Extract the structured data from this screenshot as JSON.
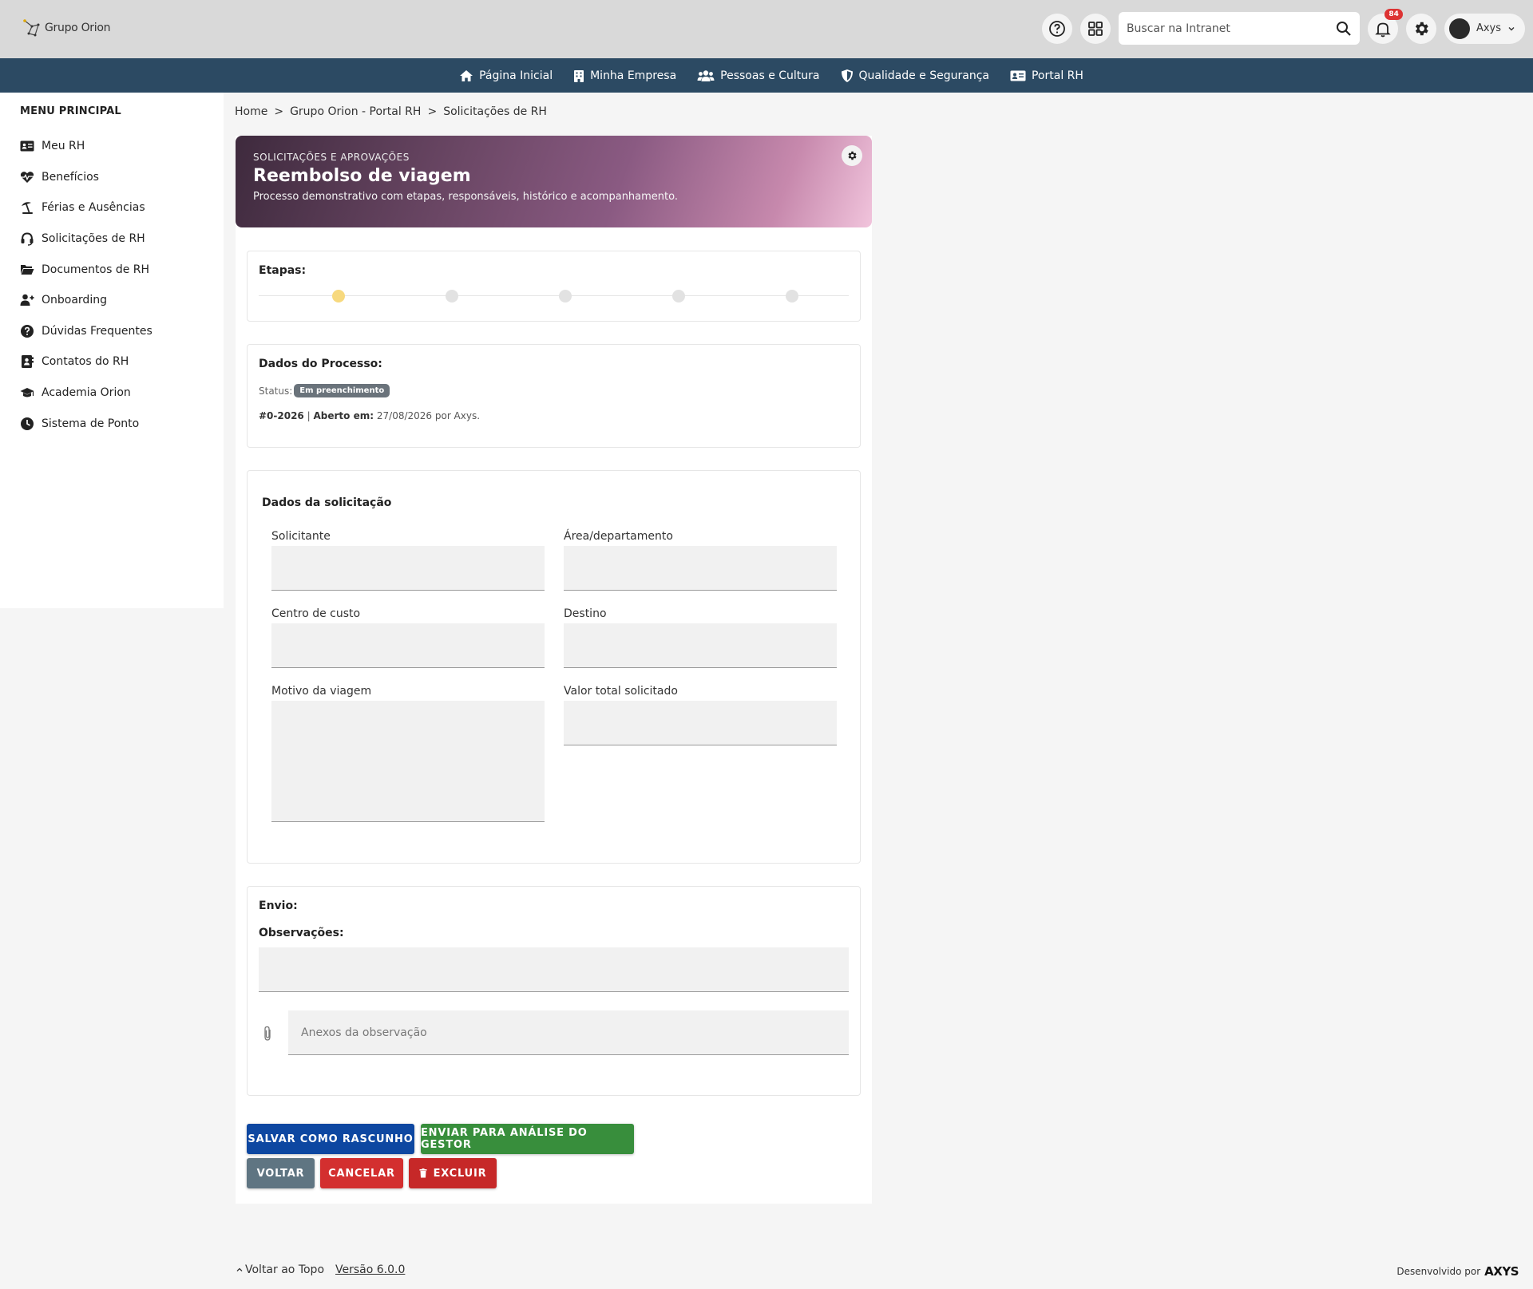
{
  "header": {
    "logo_text": "Grupo Orion",
    "search_placeholder": "Buscar na Intranet",
    "notification_count": "84",
    "user_name": "Axys"
  },
  "nav": {
    "items": [
      {
        "label": "Página Inicial",
        "icon": "home-icon"
      },
      {
        "label": "Minha Empresa",
        "icon": "building-icon"
      },
      {
        "label": "Pessoas e Cultura",
        "icon": "users-icon"
      },
      {
        "label": "Qualidade e Segurança",
        "icon": "shield-icon"
      },
      {
        "label": "Portal RH",
        "icon": "id-card-icon"
      }
    ]
  },
  "sidebar": {
    "title": "MENU PRINCIPAL",
    "items": [
      {
        "label": "Meu RH",
        "icon": "id-card-icon"
      },
      {
        "label": "Benefícios",
        "icon": "heart-pulse-icon"
      },
      {
        "label": "Férias e Ausências",
        "icon": "umbrella-beach-icon"
      },
      {
        "label": "Solicitações de RH",
        "icon": "headset-icon"
      },
      {
        "label": "Documentos de RH",
        "icon": "folder-open-icon"
      },
      {
        "label": "Onboarding",
        "icon": "user-plus-icon"
      },
      {
        "label": "Dúvidas Frequentes",
        "icon": "question-circle-icon"
      },
      {
        "label": "Contatos do RH",
        "icon": "contact-book-icon"
      },
      {
        "label": "Academia Orion",
        "icon": "graduation-cap-icon"
      },
      {
        "label": "Sistema de Ponto",
        "icon": "clock-icon"
      }
    ]
  },
  "breadcrumb": {
    "items": [
      "Home",
      "Grupo Orion - Portal RH",
      "Solicitações de RH"
    ],
    "separator": ">"
  },
  "hero": {
    "kicker": "SOLICITAÇÕES E APROVAÇÕES",
    "title": "Reembolso de viagem",
    "subtitle": "Processo demonstrativo com etapas, responsáveis, histórico e acompanhamento."
  },
  "steps": {
    "title": "Etapas:",
    "total": 5,
    "active_index": 0
  },
  "process": {
    "title": "Dados do Processo:",
    "status_label": "Status:",
    "status_value": "Em preenchimento",
    "id": "#0-2026",
    "separator": "|",
    "opened_label": "Aberto em:",
    "opened_value": "27/08/2026 por Axys."
  },
  "form": {
    "title": "Dados da solicitação",
    "fields": {
      "solicitante": {
        "label": "Solicitante",
        "value": ""
      },
      "area": {
        "label": "Área/departamento",
        "value": ""
      },
      "centro_custo": {
        "label": "Centro de custo",
        "value": ""
      },
      "destino": {
        "label": "Destino",
        "value": ""
      },
      "motivo": {
        "label": "Motivo da viagem",
        "value": ""
      },
      "valor": {
        "label": "Valor total solicitado",
        "value": ""
      }
    }
  },
  "envio": {
    "title": "Envio:",
    "obs_label": "Observações:",
    "obs_value": "",
    "attach_placeholder": "Anexos da observação"
  },
  "actions": {
    "save_draft": "SALVAR COMO RASCUNHO",
    "send_manager": "ENVIAR PARA ANÁLISE DO GESTOR",
    "back": "VOLTAR",
    "cancel": "CANCELAR",
    "delete": "EXCLUIR"
  },
  "colors": {
    "navbar": "#2c4a63",
    "save_draft": "#0d47a1",
    "send_manager": "#388e3c",
    "back": "#5f7582",
    "cancel": "#d32f2f",
    "delete": "#c62828",
    "step_active": "#f7d97e"
  },
  "footer": {
    "back_to_top": "Voltar ao Topo",
    "version": "Versão 6.0.0",
    "developed_by": "Desenvolvido por",
    "developer_logo": "AXYS"
  }
}
